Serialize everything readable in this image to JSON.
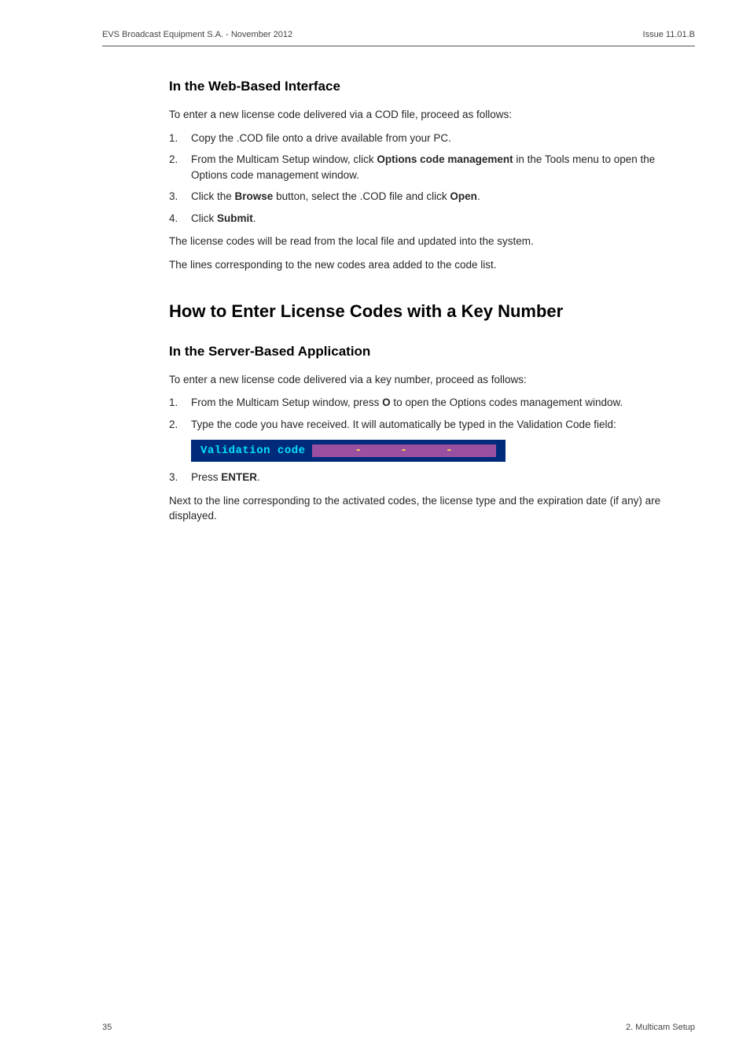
{
  "header": {
    "left": "EVS Broadcast Equipment S.A.  - November 2012",
    "right": "Issue 11.01.B"
  },
  "section1": {
    "title": "In the Web-Based Interface",
    "intro": "To enter a new license code delivered via a COD file, proceed as follows:",
    "steps": {
      "s1": "Copy the .COD file onto a drive available from your PC.",
      "s2a": "From the Multicam Setup window, click ",
      "s2b": "Options code management",
      "s2c": " in the Tools menu to open the Options code management window.",
      "s3a": "Click the ",
      "s3b": "Browse",
      "s3c": " button, select the .COD file and click ",
      "s3d": "Open",
      "s3e": ".",
      "s4a": "Click ",
      "s4b": "Submit",
      "s4c": "."
    },
    "p1": "The license codes will be read from the local file and updated into the system.",
    "p2": "The lines corresponding to the new codes area added to the code list."
  },
  "section2": {
    "title": "How to Enter License Codes with a Key Number",
    "subtitle": "In the Server-Based Application",
    "intro": "To enter a new license code delivered via a key number, proceed as follows:",
    "steps": {
      "s1a": "From the Multicam Setup window, press ",
      "s1b": "O",
      "s1c": " to open the Options codes management window.",
      "s2": "Type the code you have received. It will automatically be typed in the Validation Code field:",
      "s3a": "Press ",
      "s3b": "ENTER",
      "s3c": "."
    },
    "validation_label": "Validation code",
    "p1": "Next to the line corresponding to the activated codes, the license type and the expiration date (if any) are displayed."
  },
  "footer": {
    "left": "35",
    "right": "2. Multicam Setup"
  }
}
